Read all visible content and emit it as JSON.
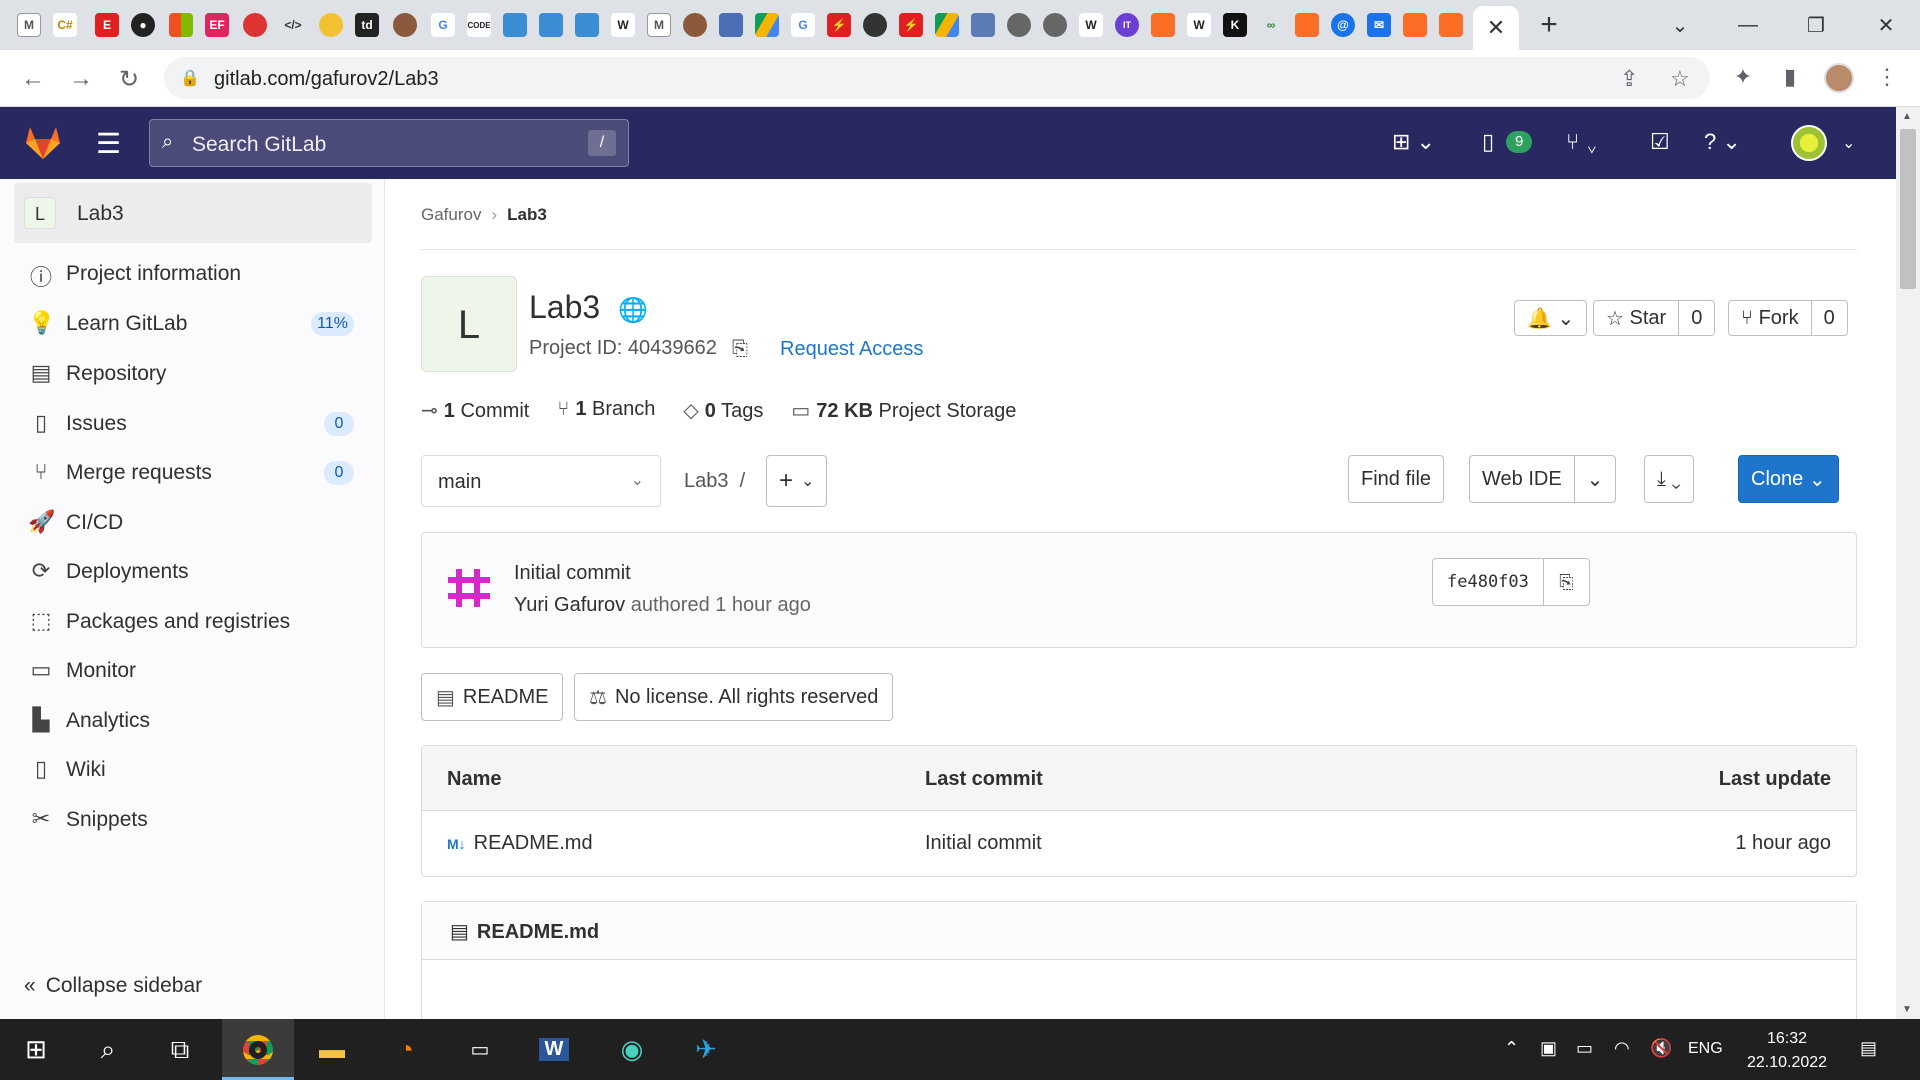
{
  "browser": {
    "url": "gitlab.com/gafurov2/Lab3",
    "tab_close": "✕",
    "new_tab": "+"
  },
  "gitlab_header": {
    "search_placeholder": "Search GitLab",
    "search_shortcut": "/",
    "todos_count": "9"
  },
  "sidebar": {
    "project_initial": "L",
    "project_name": "Lab3",
    "items": [
      {
        "label": "Project information",
        "icon": "info-icon"
      },
      {
        "label": "Learn GitLab",
        "icon": "bulb-icon",
        "badge": "11%"
      },
      {
        "label": "Repository",
        "icon": "doc-icon"
      },
      {
        "label": "Issues",
        "icon": "issues-icon",
        "badge": "0"
      },
      {
        "label": "Merge requests",
        "icon": "merge-icon",
        "badge": "0"
      },
      {
        "label": "CI/CD",
        "icon": "rocket-icon"
      },
      {
        "label": "Deployments",
        "icon": "deploy-icon"
      },
      {
        "label": "Packages and registries",
        "icon": "package-icon"
      },
      {
        "label": "Monitor",
        "icon": "monitor-icon"
      },
      {
        "label": "Analytics",
        "icon": "chart-icon"
      },
      {
        "label": "Wiki",
        "icon": "book-icon"
      },
      {
        "label": "Snippets",
        "icon": "scissors-icon"
      }
    ],
    "collapse_label": "Collapse sidebar"
  },
  "breadcrumb": {
    "parent": "Gafurov",
    "current": "Lab3"
  },
  "project": {
    "initial": "L",
    "title": "Lab3",
    "id_label": "Project ID: 40439662",
    "request_access": "Request Access",
    "star_label": "Star",
    "star_count": "0",
    "fork_label": "Fork",
    "fork_count": "0"
  },
  "stats": {
    "commits_num": "1",
    "commits_label": "Commit",
    "branches_num": "1",
    "branches_label": "Branch",
    "tags_num": "0",
    "tags_label": "Tags",
    "storage_num": "72 KB",
    "storage_label": "Project Storage"
  },
  "repo_toolbar": {
    "branch": "main",
    "path": "Lab3",
    "path_sep": "/",
    "find_file": "Find file",
    "web_ide": "Web IDE",
    "clone": "Clone"
  },
  "last_commit": {
    "message": "Initial commit",
    "author": "Yuri Gafurov",
    "meta": "authored 1 hour ago",
    "sha": "fe480f03"
  },
  "tags": {
    "readme": "README",
    "license": "No license. All rights reserved"
  },
  "file_table": {
    "headers": [
      "Name",
      "Last commit",
      "Last update"
    ],
    "rows": [
      {
        "name": "README.md",
        "commit": "Initial commit",
        "updated": "1 hour ago"
      }
    ]
  },
  "readme_box": {
    "title": "README.md"
  },
  "taskbar": {
    "lang": "ENG",
    "time": "16:32",
    "date": "22.10.2022"
  }
}
